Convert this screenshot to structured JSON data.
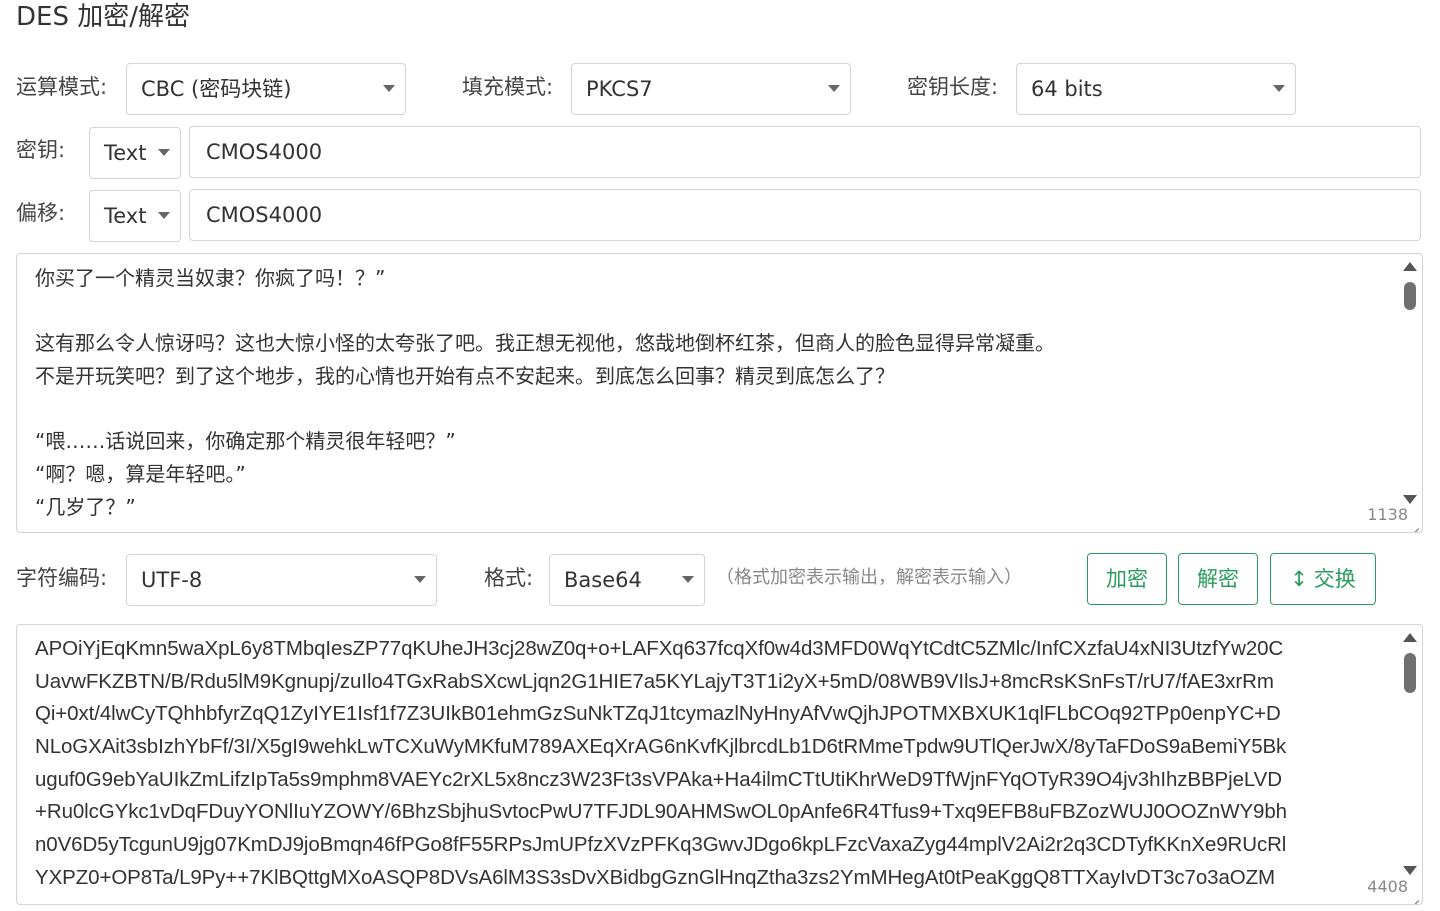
{
  "page_title": "DES 加密/解密",
  "options": {
    "mode_label": "运算模式:",
    "mode_value": "CBC (密码块链)",
    "padding_label": "填充模式:",
    "padding_value": "PKCS7",
    "keylen_label": "密钥长度:",
    "keylen_value": "64 bits"
  },
  "key": {
    "label": "密钥:",
    "type_value": "Text",
    "value": "CMOS4000"
  },
  "iv": {
    "label": "偏移:",
    "type_value": "Text",
    "value": "CMOS4000"
  },
  "input_text": {
    "lines": [
      "你买了一个精灵当奴隶？你疯了吗！？”",
      "",
      "这有那么令人惊讶吗？这也大惊小怪的太夸张了吧。我正想无视他，悠哉地倒杯红茶，但商人的脸色显得异常凝重。",
      "不是开玩笑吧？到了这个地步，我的心情也开始有点不安起来。到底怎么回事？精灵到底怎么了？",
      "",
      "“喂……话说回来，你确定那个精灵很年轻吧？”",
      "“啊？嗯，算是年轻吧。”",
      "“几岁了？”"
    ],
    "char_count": "1138"
  },
  "controls": {
    "encoding_label": "字符编码:",
    "encoding_value": "UTF-8",
    "format_label": "格式:",
    "format_value": "Base64",
    "format_hint": "（格式加密表示输出，解密表示输入）",
    "encrypt_label": "加密",
    "decrypt_label": "解密",
    "swap_label": "交换",
    "swap_icon": "up-down-arrow-icon"
  },
  "output_text": {
    "lines": [
      "APOiYjEqKmn5waXpL6y8TMbqIesZP77qKUheJH3cj28wZ0q+o+LAFXq637fcqXf0w4d3MFD0WqYtCdtC5ZMlc/InfCXzfaU4xNI3UtzfYw20C",
      "UavwFKZBTN/B/Rdu5lM9Kgnupj/zuIlo4TGxRabSXcwLjqn2G1HIE7a5KYLajyT3T1i2yX+5mD/08WB9VIlsJ+8mcRsKSnFsT/rU7/fAE3xrRm",
      "Qi+0xt/4lwCyTQhhbfyrZqQ1ZyIYE1Isf1f7Z3UIkB01ehmGzSuNkTZqJ1tcymazlNyHnyAfVwQjhJPOTMXBXUK1qlFLbCOq92TPp0enpYC+D",
      "NLoGXAit3sbIzhYbFf/3I/X5gI9wehkLwTCXuWyMKfuM789AXEqXrAG6nKvfKjlbrcdLb1D6tRMmeTpdw9UTlQerJwX/8yTaFDoS9aBemiY5Bk",
      "uguf0G9ebYaUIkZmLifzIpTa5s9mphm8VAEYc2rXL5x8ncz3W23Ft3sVPAka+Ha4ilmCTtUtiKhrWeD9TfWjnFYqOTyR39O4jv3hIhzBBPjeLVD",
      "+Ru0lcGYkc1vDqFDuyYONlIuYZOWY/6BhzSbjhuSvtocPwU7TFJDL90AHMSwOL0pAnfe6R4Tfus9+Txq9EFB8uFBZozWUJ0OOZnWY9bh",
      "n0V6D5yTcgunU9jg07KmDJ9joBmqn46fPGo8fF55RPsJmUPfzXVzPFKq3GwvJDgo6kpLFzcVaxaZyg44mplV2Ai2r2q3CDTyfKKnXe9RUcRl",
      "YXPZ0+OP8Ta/L9Py++7KlBQttgMXoASQP8DVsA6lM3S3sDvXBidbgGznGlHnqZtha3zs2YmMHegAt0tPeaKggQ8TTXayIvDT3c7o3aOZM"
    ],
    "char_count": "4408"
  }
}
